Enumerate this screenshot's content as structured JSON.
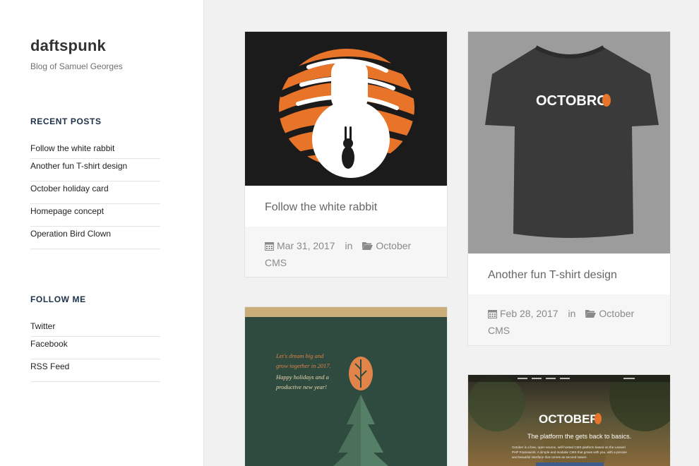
{
  "site": {
    "title": "daftspunk",
    "description": "Blog of Samuel Georges"
  },
  "recent_posts": {
    "heading": "RECENT POSTS",
    "items": [
      "Follow the white rabbit",
      "Another fun T-shirt design",
      "October holiday card",
      "Homepage concept",
      "Operation Bird Clown"
    ]
  },
  "follow_me": {
    "heading": "FOLLOW ME",
    "items": [
      "Twitter",
      "Facebook",
      "RSS Feed"
    ]
  },
  "posts": [
    {
      "title": "Follow the white rabbit",
      "date": "Mar 31, 2017",
      "in": "in",
      "category_1": "October",
      "category_2": "CMS"
    },
    {
      "title": "Another fun T-shirt design",
      "date": "Feb 28, 2017",
      "in": "in",
      "category_1": "October",
      "category_2": "CMS"
    }
  ],
  "images": {
    "tshirt_logo": "OCTOBRO",
    "holiday_line_1": "Let's dream big and",
    "holiday_line_2": "grow together in 2017.",
    "holiday_line_3": "Happy holidays and a",
    "holiday_line_4": "productive new year!",
    "homepage_logo": "OCTOBER",
    "homepage_tagline": "The platform the gets back to basics.",
    "homepage_desc_1": "October is a free, open-source, self-hosted CMS platform based on the Laravel",
    "homepage_desc_2": "PHP Framework. A simple and modular CMS that grows with you, with a precise",
    "homepage_desc_3": "and beautiful interface that comes as second nature."
  },
  "colors": {
    "accent_orange": "#e8742a",
    "heading_navy": "#1b3148",
    "tshirt_bg": "#9c9c9c",
    "holiday_green": "#2f4a3e"
  }
}
